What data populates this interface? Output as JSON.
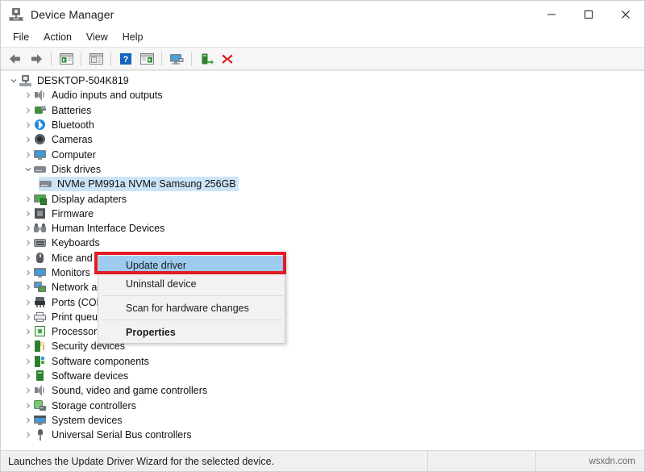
{
  "window": {
    "title": "Device Manager",
    "icon": "device-manager-icon",
    "controls": {
      "minimize": "–",
      "maximize": "□",
      "close": "✕"
    }
  },
  "menubar": {
    "items": [
      {
        "label": "File"
      },
      {
        "label": "Action"
      },
      {
        "label": "View"
      },
      {
        "label": "Help"
      }
    ]
  },
  "toolbar": {
    "buttons": [
      {
        "name": "back-arrow-icon",
        "title": "Back"
      },
      {
        "name": "forward-arrow-icon",
        "title": "Forward"
      },
      {
        "name": "show-hide-console-tree-icon",
        "title": "Show/Hide Console Tree"
      },
      {
        "name": "properties-icon",
        "title": "Properties"
      },
      {
        "name": "help-icon",
        "title": "Help"
      },
      {
        "name": "update-driver-icon",
        "title": "Update driver"
      },
      {
        "name": "scan-hardware-changes-icon",
        "title": "Scan for hardware changes"
      },
      {
        "name": "enable-device-icon",
        "title": "Enable device"
      },
      {
        "name": "uninstall-device-icon",
        "title": "Uninstall device"
      }
    ]
  },
  "tree": {
    "nodes": [
      {
        "label": "DESKTOP-504K819",
        "level": 0,
        "expanded": true,
        "icon": "computer-root-icon"
      },
      {
        "label": "Audio inputs and outputs",
        "level": 1,
        "expanded": false,
        "icon": "speaker-icon"
      },
      {
        "label": "Batteries",
        "level": 1,
        "expanded": false,
        "icon": "battery-icon"
      },
      {
        "label": "Bluetooth",
        "level": 1,
        "expanded": false,
        "icon": "bluetooth-icon"
      },
      {
        "label": "Cameras",
        "level": 1,
        "expanded": false,
        "icon": "camera-icon"
      },
      {
        "label": "Computer",
        "level": 1,
        "expanded": false,
        "icon": "monitor-icon"
      },
      {
        "label": "Disk drives",
        "level": 1,
        "expanded": true,
        "icon": "disk-icon"
      },
      {
        "label": "NVMe PM991a NVMe Samsung 256GB",
        "level": 2,
        "expanded": null,
        "icon": "disk-icon",
        "selected": true
      },
      {
        "label": "Display adapters",
        "level": 1,
        "expanded": false,
        "icon": "display-adapter-icon"
      },
      {
        "label": "Firmware",
        "level": 1,
        "expanded": false,
        "icon": "firmware-icon"
      },
      {
        "label": "Human Interface Devices",
        "level": 1,
        "expanded": false,
        "icon": "hid-icon"
      },
      {
        "label": "Keyboards",
        "level": 1,
        "expanded": false,
        "icon": "keyboard-icon"
      },
      {
        "label": "Mice and other pointing devices",
        "level": 1,
        "expanded": false,
        "icon": "mouse-icon"
      },
      {
        "label": "Monitors",
        "level": 1,
        "expanded": false,
        "icon": "monitor-icon"
      },
      {
        "label": "Network adapters",
        "level": 1,
        "expanded": false,
        "icon": "network-adapter-icon"
      },
      {
        "label": "Ports (COM & LPT)",
        "level": 1,
        "expanded": false,
        "icon": "port-icon"
      },
      {
        "label": "Print queues",
        "level": 1,
        "expanded": false,
        "icon": "printer-icon"
      },
      {
        "label": "Processors",
        "level": 1,
        "expanded": false,
        "icon": "cpu-icon"
      },
      {
        "label": "Security devices",
        "level": 1,
        "expanded": false,
        "icon": "security-device-icon"
      },
      {
        "label": "Software components",
        "level": 1,
        "expanded": false,
        "icon": "software-component-icon"
      },
      {
        "label": "Software devices",
        "level": 1,
        "expanded": false,
        "icon": "software-device-icon"
      },
      {
        "label": "Sound, video and game controllers",
        "level": 1,
        "expanded": false,
        "icon": "speaker-icon"
      },
      {
        "label": "Storage controllers",
        "level": 1,
        "expanded": false,
        "icon": "storage-controller-icon"
      },
      {
        "label": "System devices",
        "level": 1,
        "expanded": false,
        "icon": "system-device-icon"
      },
      {
        "label": "Universal Serial Bus controllers",
        "level": 1,
        "expanded": false,
        "icon": "usb-icon"
      }
    ]
  },
  "context_menu": {
    "items": [
      {
        "label": "Update driver",
        "highlighted": true,
        "bold": false
      },
      {
        "label": "Uninstall device",
        "highlighted": false,
        "bold": false
      },
      {
        "label": "Scan for hardware changes",
        "highlighted": false,
        "bold": false
      },
      {
        "label": "Properties",
        "highlighted": false,
        "bold": true
      }
    ],
    "highlight_color": "#9ecbf0",
    "annotation_color": "#e31b23"
  },
  "statusbar": {
    "text": "Launches the Update Driver Wizard for the selected device.",
    "watermark": "wsxdn.com"
  }
}
